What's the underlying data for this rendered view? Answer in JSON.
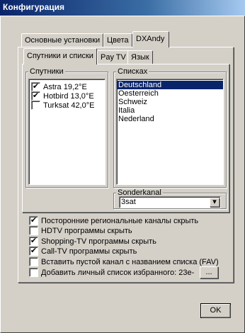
{
  "window": {
    "title": "Конфигурация"
  },
  "tabs": [
    {
      "label": "Основные установки"
    },
    {
      "label": "Цвета"
    },
    {
      "label": "DXAndy"
    }
  ],
  "subtabs": [
    {
      "label": "Спутники и списки"
    },
    {
      "label": "Pay TV"
    },
    {
      "label": "Язык"
    }
  ],
  "satellites": {
    "legend": "Спутники",
    "items": [
      {
        "label": "Astra 19,2°E",
        "checked": true
      },
      {
        "label": "Hotbird 13,0°E",
        "checked": true
      },
      {
        "label": "Turksat 42,0°E",
        "checked": false
      }
    ]
  },
  "lists": {
    "legend": "Списках",
    "items": [
      {
        "label": "Deutschland",
        "selected": true
      },
      {
        "label": "Oesterreich",
        "selected": false
      },
      {
        "label": "Schweiz",
        "selected": false
      },
      {
        "label": "Italia",
        "selected": false
      },
      {
        "label": "Nederland",
        "selected": false
      }
    ]
  },
  "sonderkanal": {
    "legend": "Sonderkanal",
    "value": "3sat"
  },
  "options": [
    {
      "label": "Посторонние региональные каналы скрыть",
      "checked": true
    },
    {
      "label": "HDTV программы скрыть",
      "checked": false
    },
    {
      "label": "Shopping-TV программы скрыть",
      "checked": true
    },
    {
      "label": "Call-TV программы скрыть",
      "checked": true
    },
    {
      "label": "Вставить пустой канал с названием списка (FAV)",
      "checked": false
    },
    {
      "label": "Добавить личный список избранного: 23e-",
      "checked": false
    }
  ],
  "buttons": {
    "browse": "...",
    "ok": "OK"
  },
  "marks": {
    "check": "✔",
    "dropdown": "▾"
  }
}
